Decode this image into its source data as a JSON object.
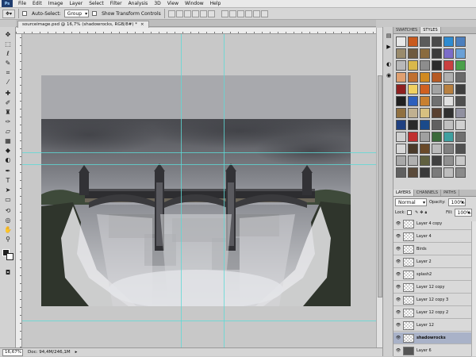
{
  "app": {
    "logo": "Ps"
  },
  "menu": [
    "File",
    "Edit",
    "Image",
    "Layer",
    "Select",
    "Filter",
    "Analysis",
    "3D",
    "View",
    "Window",
    "Help"
  ],
  "options": {
    "auto_select_label": "Auto-Select:",
    "auto_select_value": "Group",
    "show_transform_label": "Show Transform Controls"
  },
  "document": {
    "tab_title": "sourceimage.psd @ 16,7% (shadowrocks, RGB/8#) *",
    "close_glyph": "×"
  },
  "status": {
    "zoom": "16,67%",
    "doc_info": "Doc: 94,4M/246,1M"
  },
  "panels": {
    "tabs_top": [
      "SWATCHES",
      "STYLES"
    ],
    "tabs_layers": [
      "LAYERS",
      "CHANNELS",
      "PATHS"
    ],
    "blend_mode": "Normal",
    "opacity_label": "Opacity:",
    "opacity_value": "100%",
    "lock_label": "Lock:",
    "fill_label": "Fill:",
    "fill_value": "100%"
  },
  "layers": [
    {
      "name": "Layer 4 copy",
      "selected": false
    },
    {
      "name": "Layer 4",
      "selected": false
    },
    {
      "name": "Birds",
      "selected": false
    },
    {
      "name": "Layer 2",
      "selected": false
    },
    {
      "name": "splash2",
      "selected": false
    },
    {
      "name": "Layer 12 copy",
      "selected": false
    },
    {
      "name": "Layer 12 copy 3",
      "selected": false
    },
    {
      "name": "Layer 12 copy 2",
      "selected": false
    },
    {
      "name": "Layer 12",
      "selected": false
    },
    {
      "name": "shadowrocks",
      "selected": true
    },
    {
      "name": "Layer 6",
      "selected": false
    }
  ],
  "style_colors": [
    "#e8e8e8",
    "#c95a1d",
    "#5b5b5b",
    "#4a4a4a",
    "#2e8bd1",
    "#4d7fbd",
    "#9a8b6c",
    "#6f5b3f",
    "#8a6b3e",
    "#3b3b3b",
    "#7b6cc9",
    "#6aa0d6",
    "#b8b8b8",
    "#d9b84a",
    "#8d8d8d",
    "#2a2a2a",
    "#c94040",
    "#4aa04a",
    "#e0a070",
    "#c07030",
    "#d08a20",
    "#b65a24",
    "#b0b0b0",
    "#6a6a6a",
    "#8f2020",
    "#f0d060",
    "#d06020",
    "#a3a3a3",
    "#b88040",
    "#3f3f3f",
    "#202020",
    "#2c5fbd",
    "#c88030",
    "#707070",
    "#e0e0e0",
    "#4f4f4f",
    "#907040",
    "#c0b090",
    "#d7c080",
    "#5a4030",
    "#303030",
    "#9090a0",
    "#204080",
    "#2a2a2a",
    "#1a4a8a",
    "#606060",
    "#c0c0c0",
    "#d0d0d0",
    "#d0d0d0",
    "#c03030",
    "#a0a0a0",
    "#3a6a3a",
    "#40a0a0",
    "#707070",
    "#d8d8d8",
    "#4a3a2a",
    "#6a4a2a",
    "#bababa",
    "#808080",
    "#505050",
    "#a8a8a8",
    "#b0b0b0",
    "#606040",
    "#404040",
    "#909090",
    "#c8c8c8",
    "#606060",
    "#5a4a3a",
    "#3a3a3a",
    "#7a7a7a",
    "#bdbdbd",
    "#8a8a8a"
  ]
}
